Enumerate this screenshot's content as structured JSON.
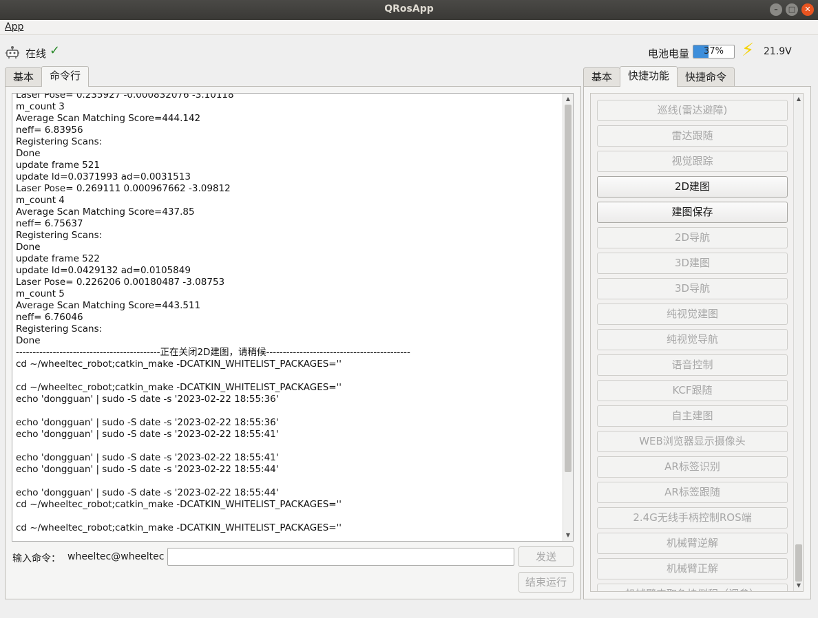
{
  "window": {
    "title": "QRosApp",
    "controls": [
      "–",
      "□",
      "✕"
    ]
  },
  "menubar": {
    "items": [
      {
        "label": "App"
      }
    ]
  },
  "status": {
    "connection": "在线",
    "connection_icon": "✓",
    "battery_label": "电池电量",
    "battery_percent": 37,
    "battery_text": "37%",
    "voltage": "21.9V",
    "bolt_icon": "⚡"
  },
  "left_tabs": [
    {
      "label": "基本"
    },
    {
      "label": "命令行",
      "active": true
    }
  ],
  "right_tabs": [
    {
      "label": "基本"
    },
    {
      "label": "快捷功能",
      "active": true
    },
    {
      "label": "快捷命令"
    }
  ],
  "console": {
    "lines": [
      "Laser Pose= 0.235927 -0.000832076 -3.10118",
      "m_count 3",
      "Average Scan Matching Score=444.142",
      "neff= 6.83956",
      "Registering Scans:",
      "Done",
      "update frame 521",
      "update ld=0.0371993 ad=0.0031513",
      "Laser Pose= 0.269111 0.000967662 -3.09812",
      "m_count 4",
      "Average Scan Matching Score=437.85",
      "neff= 6.75637",
      "Registering Scans:",
      "Done",
      "update frame 522",
      "update ld=0.0429132 ad=0.0105849",
      "Laser Pose= 0.226206 0.00180487 -3.08753",
      "m_count 5",
      "Average Scan Matching Score=443.511",
      "neff= 6.76046",
      "Registering Scans:",
      "Done",
      "-------------------------------------------正在关闭2D建图，请稍候-------------------------------------------",
      "cd ~/wheeltec_robot;catkin_make -DCATKIN_WHITELIST_PACKAGES=''",
      "",
      "cd ~/wheeltec_robot;catkin_make -DCATKIN_WHITELIST_PACKAGES=''",
      "echo 'dongguan' | sudo -S date -s '2023-02-22 18:55:36'",
      "",
      "echo 'dongguan' | sudo -S date -s '2023-02-22 18:55:36'",
      "echo 'dongguan' | sudo -S date -s '2023-02-22 18:55:41'",
      "",
      "echo 'dongguan' | sudo -S date -s '2023-02-22 18:55:41'",
      "echo 'dongguan' | sudo -S date -s '2023-02-22 18:55:44'",
      "",
      "echo 'dongguan' | sudo -S date -s '2023-02-22 18:55:44'",
      "cd ~/wheeltec_robot;catkin_make -DCATKIN_WHITELIST_PACKAGES=''",
      "",
      "cd ~/wheeltec_robot;catkin_make -DCATKIN_WHITELIST_PACKAGES=''"
    ]
  },
  "command": {
    "label": "输入命令：",
    "user": "wheeltec@wheeltec",
    "value": "",
    "send_label": "发送",
    "stop_label": "结束运行"
  },
  "quick_functions": [
    {
      "label": "巡线(雷达避障)",
      "enabled": false
    },
    {
      "label": "雷达跟随",
      "enabled": false
    },
    {
      "label": "视觉跟踪",
      "enabled": false
    },
    {
      "label": "2D建图",
      "enabled": true
    },
    {
      "label": "建图保存",
      "enabled": true
    },
    {
      "label": "2D导航",
      "enabled": false
    },
    {
      "label": "3D建图",
      "enabled": false
    },
    {
      "label": "3D导航",
      "enabled": false
    },
    {
      "label": "纯视觉建图",
      "enabled": false
    },
    {
      "label": "纯视觉导航",
      "enabled": false
    },
    {
      "label": "语音控制",
      "enabled": false
    },
    {
      "label": "KCF跟随",
      "enabled": false
    },
    {
      "label": "自主建图",
      "enabled": false
    },
    {
      "label": "WEB浏览器显示摄像头",
      "enabled": false
    },
    {
      "label": "AR标签识别",
      "enabled": false
    },
    {
      "label": "AR标签跟随",
      "enabled": false
    },
    {
      "label": "2.4G无线手柄控制ROS端",
      "enabled": false
    },
    {
      "label": "机械臂逆解",
      "enabled": false
    },
    {
      "label": "机械臂正解",
      "enabled": false
    },
    {
      "label": "机械臂夹取色块例程（调参）",
      "enabled": false
    }
  ],
  "colors": {
    "accent": "#3d8edb",
    "close": "#e95420",
    "bolt": "#f5d200",
    "check": "#2a8a2a"
  }
}
